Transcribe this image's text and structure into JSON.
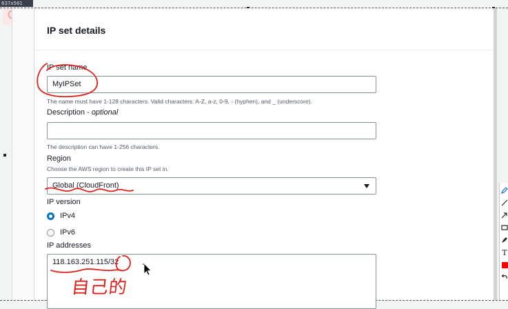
{
  "capture_badge": "637x561",
  "panel": {
    "title": "IP set details"
  },
  "ip_set_name": {
    "label": "IP set name",
    "value": "MyIPSet",
    "hint": "The name must have 1-128 characters. Valid characters: A-Z, a-z, 0-9, - (hyphen), and _ (underscore)."
  },
  "description": {
    "label": "Description",
    "label_suffix": "optional",
    "label_sep": " - ",
    "value": "",
    "hint": "The description can have 1-256 characters."
  },
  "region": {
    "label": "Region",
    "hint": "Choose the AWS region to create this IP set in.",
    "value": "Global (CloudFront)"
  },
  "ip_version": {
    "label": "IP version",
    "options": [
      {
        "label": "IPv4",
        "selected": true
      },
      {
        "label": "IPv6",
        "selected": false
      }
    ]
  },
  "ip_addresses": {
    "label": "IP addresses",
    "value": "118.163.251.115/32"
  },
  "handwriting": "自己的",
  "toolbar": {
    "tools": [
      "pen-icon",
      "line-icon",
      "arrow-icon",
      "rectangle-icon",
      "marker-icon",
      "text-icon",
      "color-swatch",
      "undo-icon"
    ],
    "text_tool_glyph": "T",
    "active_color": "#ff0000"
  },
  "annotation_color": "#e0201a",
  "accent_color": "#0073bb"
}
